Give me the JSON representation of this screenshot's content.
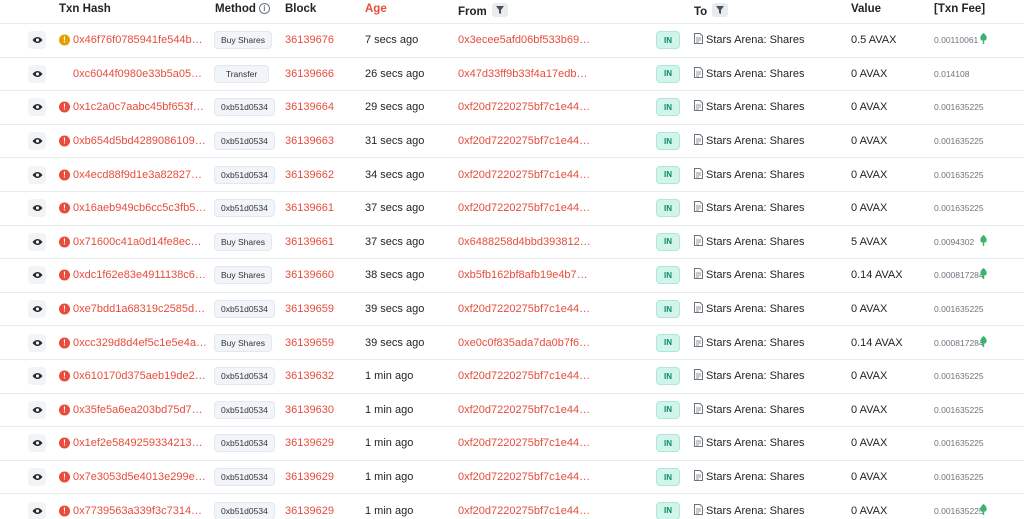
{
  "header": {
    "txn_hash": "Txn Hash",
    "method": "Method",
    "block": "Block",
    "age": "Age",
    "from": "From",
    "to": "To",
    "value": "Value",
    "txn_fee": "[Txn Fee]"
  },
  "colors": {
    "accent_red": "#e74c3c",
    "in_badge_bg": "#d1f5ea",
    "in_badge_text": "#0a8a66"
  },
  "rows": [
    {
      "status": "warn",
      "hash": "0x46f76f0785941fe544b…",
      "method": "Buy Shares",
      "block": "36139676",
      "age": "7 secs ago",
      "from": "0x3ecee5afd06bf533b69…",
      "direction": "IN",
      "to": "Stars Arena: Shares",
      "value": "0.5 AVAX",
      "fee": "0.00110061",
      "gas_icon": true
    },
    {
      "status": "none",
      "hash": "0xc6044f0980e33b5a05…",
      "method": "Transfer",
      "block": "36139666",
      "age": "26 secs ago",
      "from": "0x47d33ff9b33f4a17edb…",
      "direction": "IN",
      "to": "Stars Arena: Shares",
      "value": "0 AVAX",
      "fee": "0.014108",
      "gas_icon": false
    },
    {
      "status": "err",
      "hash": "0x1c2a0c7aabc45bf653f…",
      "method": "0xb51d0534",
      "block": "36139664",
      "age": "29 secs ago",
      "from": "0xf20d7220275bf7c1e44…",
      "direction": "IN",
      "to": "Stars Arena: Shares",
      "value": "0 AVAX",
      "fee": "0.001635225",
      "gas_icon": false
    },
    {
      "status": "err",
      "hash": "0xb654d5bd4289086109…",
      "method": "0xb51d0534",
      "block": "36139663",
      "age": "31 secs ago",
      "from": "0xf20d7220275bf7c1e44…",
      "direction": "IN",
      "to": "Stars Arena: Shares",
      "value": "0 AVAX",
      "fee": "0.001635225",
      "gas_icon": false
    },
    {
      "status": "err",
      "hash": "0x4ecd88f9d1e3a82827…",
      "method": "0xb51d0534",
      "block": "36139662",
      "age": "34 secs ago",
      "from": "0xf20d7220275bf7c1e44…",
      "direction": "IN",
      "to": "Stars Arena: Shares",
      "value": "0 AVAX",
      "fee": "0.001635225",
      "gas_icon": false
    },
    {
      "status": "err",
      "hash": "0x16aeb949cb6cc5c3fb5…",
      "method": "0xb51d0534",
      "block": "36139661",
      "age": "37 secs ago",
      "from": "0xf20d7220275bf7c1e44…",
      "direction": "IN",
      "to": "Stars Arena: Shares",
      "value": "0 AVAX",
      "fee": "0.001635225",
      "gas_icon": false
    },
    {
      "status": "err",
      "hash": "0x71600c41a0d14fe8ec…",
      "method": "Buy Shares",
      "block": "36139661",
      "age": "37 secs ago",
      "from": "0x6488258d4bbd393812…",
      "direction": "IN",
      "to": "Stars Arena: Shares",
      "value": "5 AVAX",
      "fee": "0.0094302",
      "gas_icon": true
    },
    {
      "status": "err",
      "hash": "0xdc1f62e83e4911138c6…",
      "method": "Buy Shares",
      "block": "36139660",
      "age": "38 secs ago",
      "from": "0xb5fb162bf8afb19e4b7…",
      "direction": "IN",
      "to": "Stars Arena: Shares",
      "value": "0.14 AVAX",
      "fee": "0.000817284",
      "gas_icon": true
    },
    {
      "status": "err",
      "hash": "0xe7bdd1a68319c2585d…",
      "method": "0xb51d0534",
      "block": "36139659",
      "age": "39 secs ago",
      "from": "0xf20d7220275bf7c1e44…",
      "direction": "IN",
      "to": "Stars Arena: Shares",
      "value": "0 AVAX",
      "fee": "0.001635225",
      "gas_icon": false
    },
    {
      "status": "err",
      "hash": "0xcc329d8d4ef5c1e5e4a…",
      "method": "Buy Shares",
      "block": "36139659",
      "age": "39 secs ago",
      "from": "0xe0c0f835ada7da0b7f6…",
      "direction": "IN",
      "to": "Stars Arena: Shares",
      "value": "0.14 AVAX",
      "fee": "0.000817284",
      "gas_icon": true
    },
    {
      "status": "err",
      "hash": "0x610170d375aeb19de2…",
      "method": "0xb51d0534",
      "block": "36139632",
      "age": "1 min ago",
      "from": "0xf20d7220275bf7c1e44…",
      "direction": "IN",
      "to": "Stars Arena: Shares",
      "value": "0 AVAX",
      "fee": "0.001635225",
      "gas_icon": false
    },
    {
      "status": "err",
      "hash": "0x35fe5a6ea203bd75d7…",
      "method": "0xb51d0534",
      "block": "36139630",
      "age": "1 min ago",
      "from": "0xf20d7220275bf7c1e44…",
      "direction": "IN",
      "to": "Stars Arena: Shares",
      "value": "0 AVAX",
      "fee": "0.001635225",
      "gas_icon": false
    },
    {
      "status": "err",
      "hash": "0x1ef2e5849259334213…",
      "method": "0xb51d0534",
      "block": "36139629",
      "age": "1 min ago",
      "from": "0xf20d7220275bf7c1e44…",
      "direction": "IN",
      "to": "Stars Arena: Shares",
      "value": "0 AVAX",
      "fee": "0.001635225",
      "gas_icon": false
    },
    {
      "status": "err",
      "hash": "0x7e3053d5e4013e299e…",
      "method": "0xb51d0534",
      "block": "36139629",
      "age": "1 min ago",
      "from": "0xf20d7220275bf7c1e44…",
      "direction": "IN",
      "to": "Stars Arena: Shares",
      "value": "0 AVAX",
      "fee": "0.001635225",
      "gas_icon": false
    },
    {
      "status": "err",
      "hash": "0x7739563a339f3c7314…",
      "method": "0xb51d0534",
      "block": "36139629",
      "age": "1 min ago",
      "from": "0xf20d7220275bf7c1e44…",
      "direction": "IN",
      "to": "Stars Arena: Shares",
      "value": "0 AVAX",
      "fee": "0.001635225",
      "gas_icon": true
    }
  ]
}
